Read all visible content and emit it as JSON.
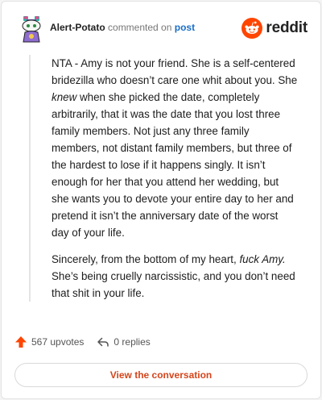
{
  "header": {
    "username": "Alert-Potato",
    "action_text": "commented on",
    "post_link": "post",
    "brand": "reddit"
  },
  "comment": {
    "paragraph1": {
      "before_em": "NTA - Amy is not your friend. She is a self-centered bridezilla who doesn’t care one whit about you. She ",
      "em": "knew",
      "after_em": " when she picked the date, completely arbitrarily, that it was the date that you lost three family members. Not just any three family members, not distant family members, but three of the hardest to lose if it happens singly. It isn’t enough for her that you attend her wedding, but she wants you to devote your entire day to her and pretend it isn’t the anniversary date of the worst day of your life."
    },
    "paragraph2": {
      "before_em": "Sincerely, from the bottom of my heart, ",
      "em": "fuck Amy.",
      "after_em": " She’s being cruelly narcissistic, and you don’t need that shit in your life."
    }
  },
  "actions": {
    "upvotes": "567 upvotes",
    "replies": "0 replies"
  },
  "cta": {
    "label": "View the conversation"
  },
  "colors": {
    "brand_orange": "#ff4500",
    "cta_text": "#d5451b",
    "link_blue": "#1a6ec7"
  },
  "icons": {
    "avatar": "snoo-avatar",
    "brand": "reddit-logo-icon",
    "upvote": "upvote-arrow-icon",
    "reply": "reply-arrow-icon"
  }
}
